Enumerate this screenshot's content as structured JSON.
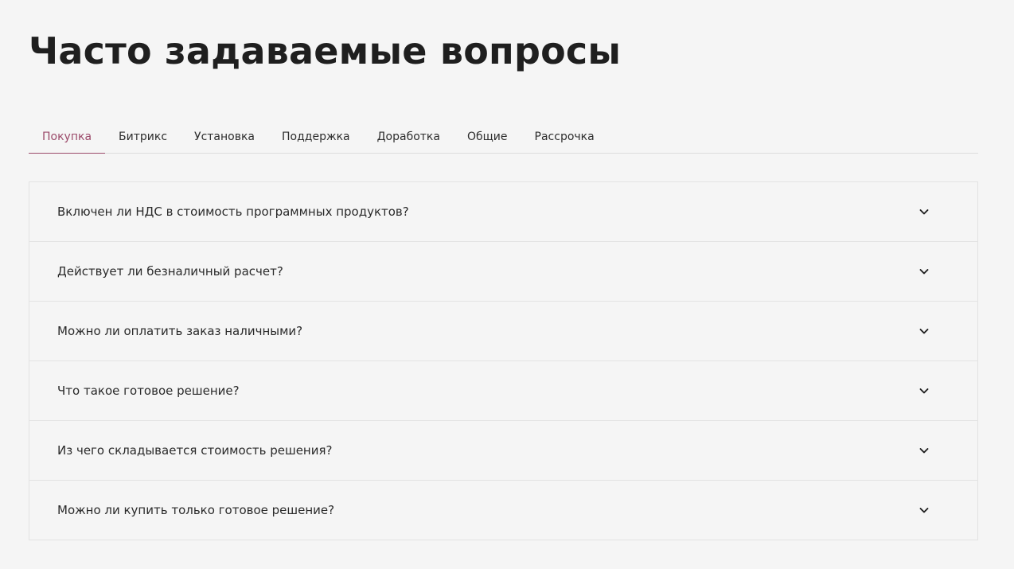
{
  "page": {
    "title": "Часто задаваемые вопросы"
  },
  "tabs": [
    {
      "label": "Покупка",
      "active": true
    },
    {
      "label": "Битрикс",
      "active": false
    },
    {
      "label": "Установка",
      "active": false
    },
    {
      "label": "Поддержка",
      "active": false
    },
    {
      "label": "Доработка",
      "active": false
    },
    {
      "label": "Общие",
      "active": false
    },
    {
      "label": "Рассрочка",
      "active": false
    }
  ],
  "faq": {
    "items": [
      {
        "question": "Включен ли НДС в стоимость программных продуктов?",
        "icon": "chevron-down-icon"
      },
      {
        "question": "Действует ли безналичный расчет?",
        "icon": "chevron-down-icon"
      },
      {
        "question": "Можно ли оплатить заказ наличными?",
        "icon": "chevron-down-icon"
      },
      {
        "question": "Что такое готовое решение?",
        "icon": "chevron-down-icon"
      },
      {
        "question": "Из чего складывается стоимость решения?",
        "icon": "chevron-down-icon"
      },
      {
        "question": "Можно ли купить только готовое решение?",
        "icon": "chevron-down-icon"
      }
    ]
  },
  "colors": {
    "background": "#f5f5f5",
    "text": "#1f1f1f",
    "accent": "#9b4a6a",
    "border": "#e3e3e3"
  }
}
